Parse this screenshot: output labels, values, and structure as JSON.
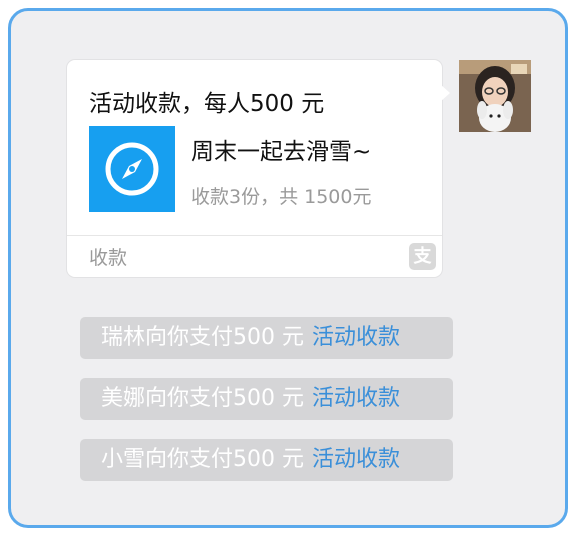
{
  "activity": {
    "title": "活动收款，每人500 元",
    "subject": "周末一起去滑雪~",
    "summary": "收款3份，共 1500元",
    "footer_label": "收款",
    "app_icon": "compass-icon",
    "footer_icon": "alipay-icon",
    "footer_icon_glyph": "支"
  },
  "notifications": [
    {
      "text": "瑞林向你支付500 元",
      "link": "活动收款"
    },
    {
      "text": "美娜向你支付500 元",
      "link": "活动收款"
    },
    {
      "text": "小雪向你支付500 元",
      "link": "活动收款"
    }
  ],
  "colors": {
    "frame_border": "#5aa9ec",
    "background": "#efeff1",
    "app_icon_bg": "#179ff0",
    "link": "#3a8fd9",
    "notice_bg": "#d5d5d7"
  }
}
